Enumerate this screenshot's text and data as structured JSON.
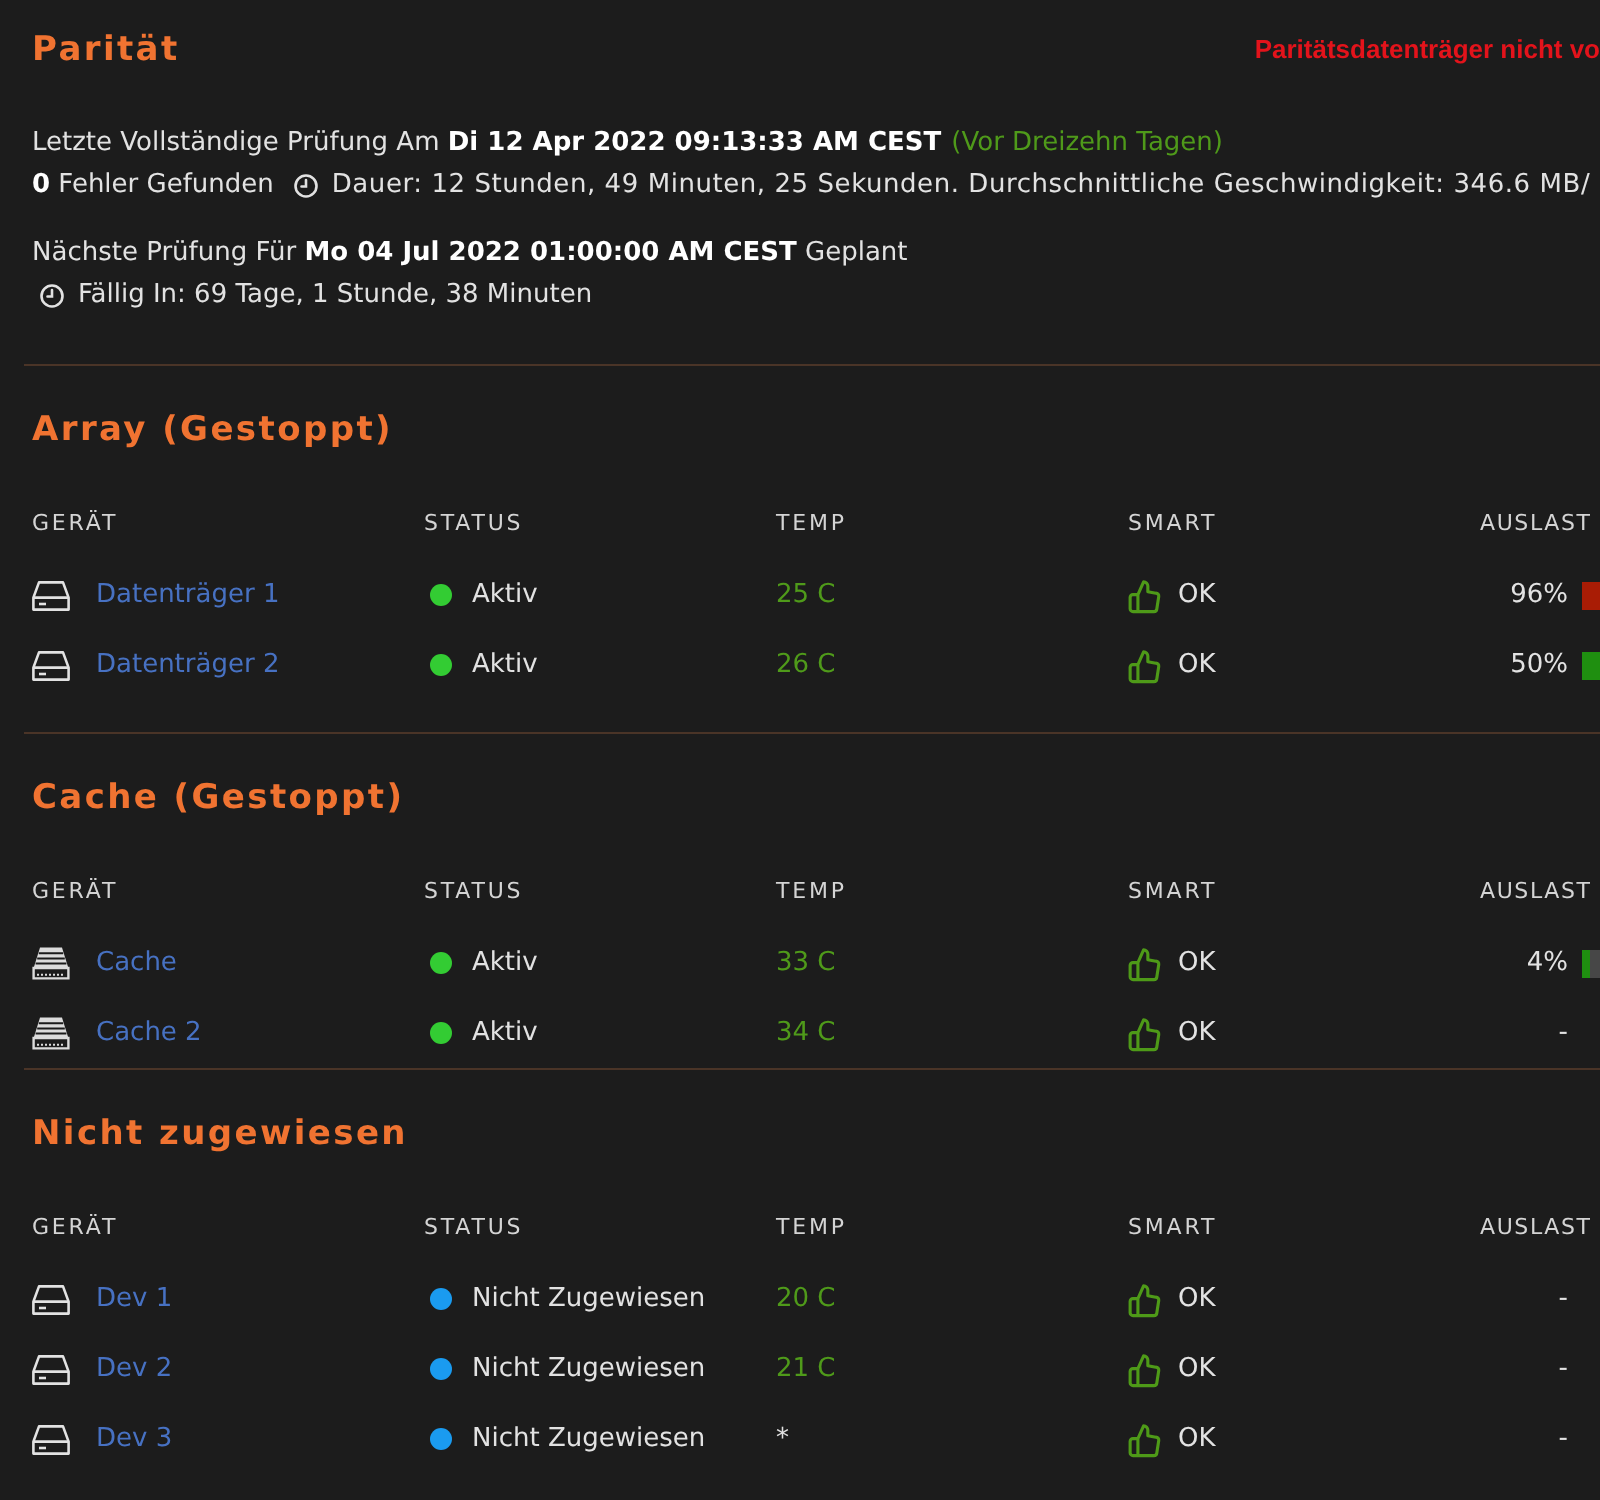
{
  "parity": {
    "title": "Parität",
    "warning": "Paritätsdatenträger nicht vo",
    "last_check": "Letzte Vollständige Prüfung Am **Di 12 Apr 2022 09:13:33 AM CEST**",
    "last_check_age": "(Vor Dreizehn Tagen)",
    "errors": "**0** Fehler Gefunden",
    "duration": "Dauer: 12 Stunden, 49 Minuten, 25 Sekunden. Durchschnittliche Geschwindigkeit: 346.6 MB/",
    "next_check": "Nächste Prüfung Für **Mo 04 Jul 2022 01:00:00 AM CEST** Geplant",
    "due": "Fällig In: 69 Tage, 1 Stunde, 38 Minuten"
  },
  "sections": [
    {
      "title": "Array (Gestoppt)",
      "columns": [
        "GERÄT",
        "STATUS",
        "TEMP",
        "SMART",
        "AUSLAST"
      ],
      "rows": [
        {
          "kind": "hdd",
          "device": "Datenträger 1",
          "status": "Aktiv",
          "color": "#33cc33",
          "temp": "25 C",
          "temp_read": true,
          "smart": "OK",
          "usage": {
            "text": "96%",
            "level": 0.96
          }
        },
        {
          "kind": "hdd",
          "device": "Datenträger 2",
          "status": "Aktiv",
          "color": "#33cc33",
          "temp": "26 C",
          "temp_read": true,
          "smart": "OK",
          "usage": {
            "text": "50%",
            "level": 0.5
          }
        }
      ]
    },
    {
      "title": "Cache (Gestoppt)",
      "columns": [
        "GERÄT",
        "STATUS",
        "TEMP",
        "SMART",
        "AUSLAST"
      ],
      "rows": [
        {
          "kind": "ssd",
          "device": "Cache",
          "status": "Aktiv",
          "color": "#33cc33",
          "temp": "33 C",
          "temp_read": true,
          "smart": "OK",
          "usage": {
            "text": "4%",
            "level": 0.04
          }
        },
        {
          "kind": "ssd",
          "device": "Cache 2",
          "status": "Aktiv",
          "color": "#33cc33",
          "temp": "34 C",
          "temp_read": true,
          "smart": "OK",
          "usage": {
            "text": "-"
          }
        }
      ]
    },
    {
      "title": "Nicht zugewiesen",
      "columns": [
        "GERÄT",
        "STATUS",
        "TEMP",
        "SMART",
        "AUSLAST"
      ],
      "rows": [
        {
          "kind": "hdd",
          "device": "Dev 1",
          "status": "Nicht Zugewiesen",
          "color": "#1a9bf0",
          "temp": "20 C",
          "temp_read": true,
          "smart": "OK",
          "usage": {
            "text": "-"
          }
        },
        {
          "kind": "hdd",
          "device": "Dev 2",
          "status": "Nicht Zugewiesen",
          "color": "#1a9bf0",
          "temp": "21 C",
          "temp_read": true,
          "smart": "OK",
          "usage": {
            "text": "-"
          }
        },
        {
          "kind": "hdd",
          "device": "Dev 3",
          "status": "Nicht Zugewiesen",
          "color": "#1a9bf0",
          "temp": "*",
          "temp_read": false,
          "smart": "OK",
          "usage": {
            "text": "-"
          }
        }
      ]
    }
  ]
}
